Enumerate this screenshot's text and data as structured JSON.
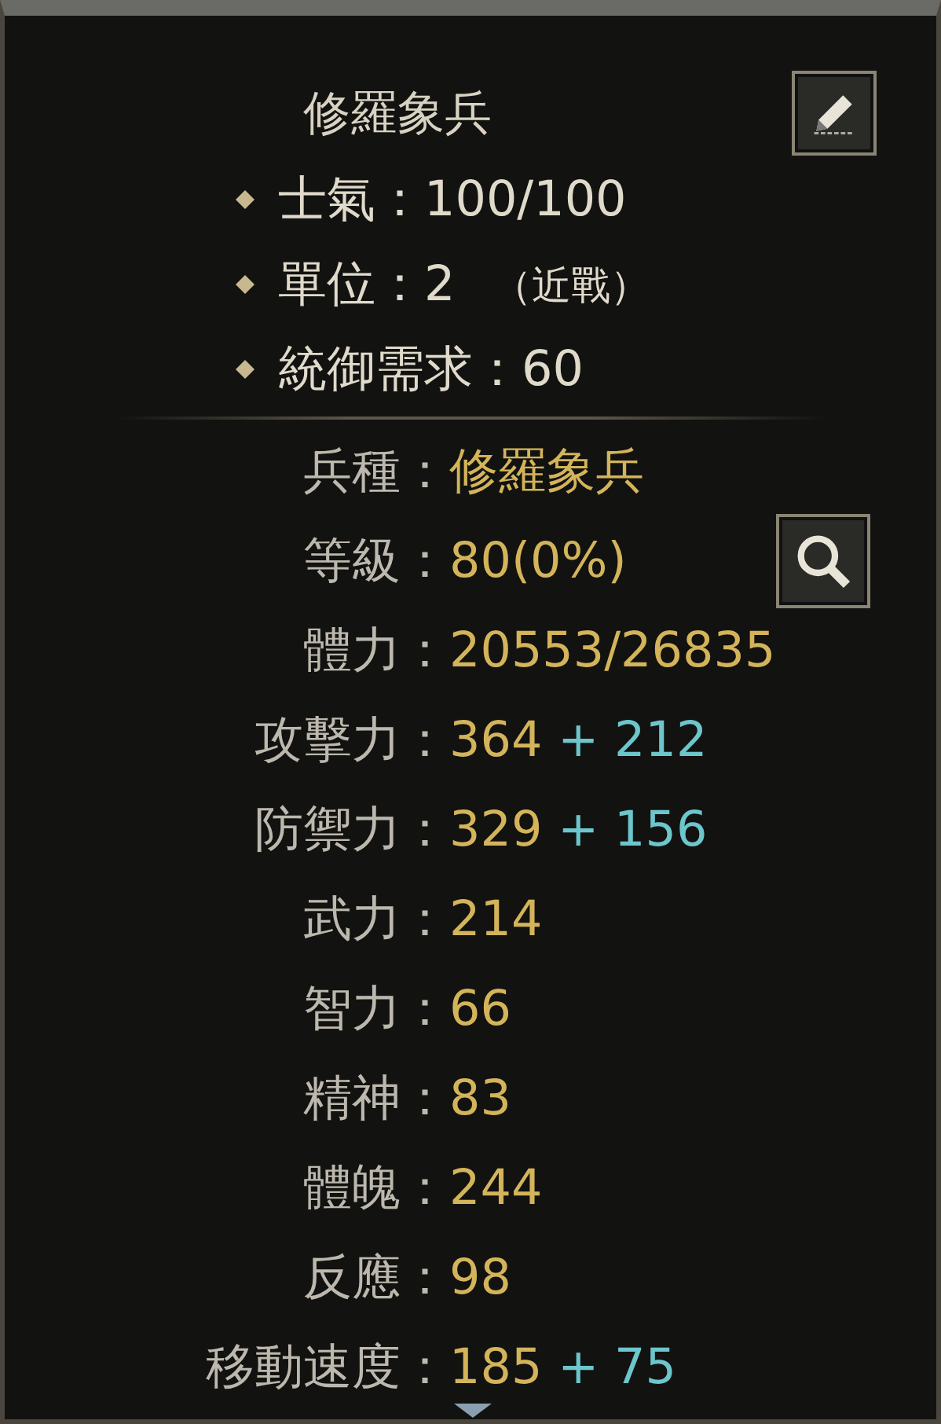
{
  "unit_name": "修羅象兵",
  "attributes": [
    {
      "text": "士氣：100/100"
    },
    {
      "text": "單位：2",
      "note": "（近戰）"
    },
    {
      "text": "統御需求：60"
    }
  ],
  "stats": [
    {
      "label": "兵種：",
      "value": "修羅象兵"
    },
    {
      "label": "等級：",
      "value": "80(0%)",
      "kind": "zoom"
    },
    {
      "label": "體力：",
      "value": "20553/26835"
    },
    {
      "label": "攻擊力：",
      "value": "364",
      "bonus": "+ 212"
    },
    {
      "label": "防禦力：",
      "value": "329",
      "bonus": "+ 156"
    },
    {
      "label": "武力：",
      "value": "214"
    },
    {
      "label": "智力：",
      "value": "66"
    },
    {
      "label": "精神：",
      "value": "83"
    },
    {
      "label": "體魄：",
      "value": "244"
    },
    {
      "label": "反應：",
      "value": "98"
    },
    {
      "label": "移動速度：",
      "value": "185",
      "bonus": "+ 75"
    }
  ]
}
